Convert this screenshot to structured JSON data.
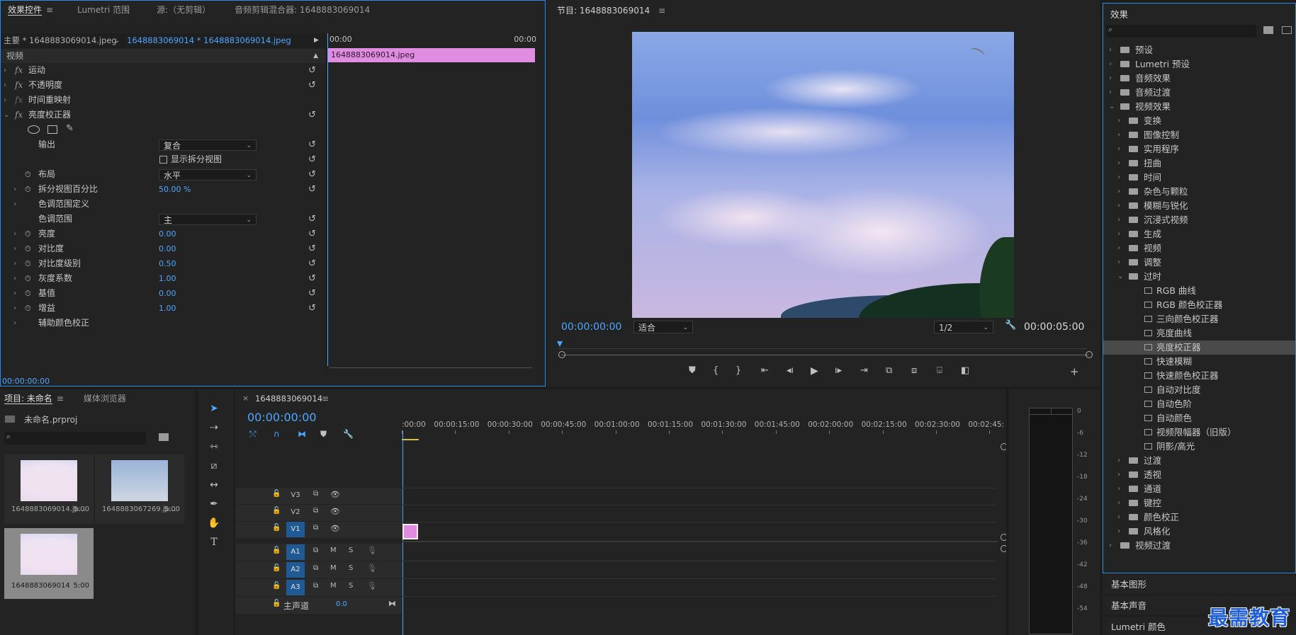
{
  "effect_controls": {
    "tabs": [
      "效果控件",
      "Lumetri 范围",
      "源:（无剪辑）",
      "音频剪辑混合器: 1648883069014"
    ],
    "master_clip": "主要 * 1648883069014.jpeg",
    "sequence_clip": "1648883069014 * 1648883069014.jpeg",
    "time_start": "00:00",
    "time_end": "00:00",
    "clip_bar_label": "1648883069014.jpeg",
    "section_video": "视频",
    "fx_rows": [
      {
        "label": "运动"
      },
      {
        "label": "不透明度"
      },
      {
        "label": "时间重映射"
      },
      {
        "label": "亮度校正器"
      }
    ],
    "output_label": "输出",
    "output_value": "复合",
    "split_view_label": "显示拆分视图",
    "layout_label": "布局",
    "layout_value": "水平",
    "split_pct_label": "拆分视图百分比",
    "split_pct_value": "50.00 %",
    "tonal_def_label": "色调范围定义",
    "tonal_range_label": "色调范围",
    "tonal_range_value": "主",
    "params": [
      {
        "label": "亮度",
        "value": "0.00"
      },
      {
        "label": "对比度",
        "value": "0.00"
      },
      {
        "label": "对比度级别",
        "value": "0.50"
      },
      {
        "label": "灰度系数",
        "value": "1.00"
      },
      {
        "label": "基值",
        "value": "0.00"
      },
      {
        "label": "增益",
        "value": "1.00"
      }
    ],
    "secondary_label": "辅助颜色校正",
    "footer_time": "00:00:00:00"
  },
  "program": {
    "title": "节目: 1648883069014",
    "current_time": "00:00:00:00",
    "fit": "适合",
    "resolution": "1/2",
    "duration": "00:00:05:00"
  },
  "effects": {
    "title": "效果",
    "items": [
      {
        "label": "预设",
        "level": 0,
        "kind": "folder",
        "open": false
      },
      {
        "label": "Lumetri 预设",
        "level": 0,
        "kind": "folder",
        "open": false
      },
      {
        "label": "音频效果",
        "level": 0,
        "kind": "folder",
        "open": false
      },
      {
        "label": "音频过渡",
        "level": 0,
        "kind": "folder",
        "open": false
      },
      {
        "label": "视频效果",
        "level": 0,
        "kind": "folder",
        "open": true
      },
      {
        "label": "变换",
        "level": 1,
        "kind": "folder",
        "open": false
      },
      {
        "label": "图像控制",
        "level": 1,
        "kind": "folder",
        "open": false
      },
      {
        "label": "实用程序",
        "level": 1,
        "kind": "folder",
        "open": false
      },
      {
        "label": "扭曲",
        "level": 1,
        "kind": "folder",
        "open": false
      },
      {
        "label": "时间",
        "level": 1,
        "kind": "folder",
        "open": false
      },
      {
        "label": "杂色与颗粒",
        "level": 1,
        "kind": "folder",
        "open": false
      },
      {
        "label": "模糊与锐化",
        "level": 1,
        "kind": "folder",
        "open": false
      },
      {
        "label": "沉浸式视频",
        "level": 1,
        "kind": "folder",
        "open": false
      },
      {
        "label": "生成",
        "level": 1,
        "kind": "folder",
        "open": false
      },
      {
        "label": "视频",
        "level": 1,
        "kind": "folder",
        "open": false
      },
      {
        "label": "调整",
        "level": 1,
        "kind": "folder",
        "open": false
      },
      {
        "label": "过时",
        "level": 1,
        "kind": "folder",
        "open": true
      },
      {
        "label": "RGB 曲线",
        "level": 2,
        "kind": "effect"
      },
      {
        "label": "RGB 颜色校正器",
        "level": 2,
        "kind": "effect"
      },
      {
        "label": "三向颜色校正器",
        "level": 2,
        "kind": "effect"
      },
      {
        "label": "亮度曲线",
        "level": 2,
        "kind": "effect"
      },
      {
        "label": "亮度校正器",
        "level": 2,
        "kind": "effect",
        "selected": true
      },
      {
        "label": "快速模糊",
        "level": 2,
        "kind": "effect"
      },
      {
        "label": "快速颜色校正器",
        "level": 2,
        "kind": "effect"
      },
      {
        "label": "自动对比度",
        "level": 2,
        "kind": "effect"
      },
      {
        "label": "自动色阶",
        "level": 2,
        "kind": "effect"
      },
      {
        "label": "自动颜色",
        "level": 2,
        "kind": "effect"
      },
      {
        "label": "视频限幅器（旧版）",
        "level": 2,
        "kind": "effect"
      },
      {
        "label": "阴影/高光",
        "level": 2,
        "kind": "effect"
      },
      {
        "label": "过渡",
        "level": 1,
        "kind": "folder",
        "open": false
      },
      {
        "label": "透视",
        "level": 1,
        "kind": "folder",
        "open": false
      },
      {
        "label": "通道",
        "level": 1,
        "kind": "folder",
        "open": false
      },
      {
        "label": "键控",
        "level": 1,
        "kind": "folder",
        "open": false
      },
      {
        "label": "颜色校正",
        "level": 1,
        "kind": "folder",
        "open": false
      },
      {
        "label": "风格化",
        "level": 1,
        "kind": "folder",
        "open": false
      },
      {
        "label": "视频过渡",
        "level": 0,
        "kind": "folder",
        "open": false
      }
    ],
    "bottom_panels": [
      "基本图形",
      "基本声音",
      "Lumetri 颜色"
    ]
  },
  "project": {
    "tabs": [
      "项目: 未命名",
      "媒体浏览器"
    ],
    "file": "未命名.prproj",
    "thumbs": [
      {
        "name": "1648883069014.jp...",
        "dur": "5:00"
      },
      {
        "name": "1648883067269.jp...",
        "dur": "5:00"
      },
      {
        "name": "1648883069014",
        "dur": "5:00"
      }
    ]
  },
  "timeline": {
    "tab": "1648883069014",
    "timecode": "00:00:00:00",
    "ruler": [
      ":00:00",
      "00:00:15:00",
      "00:00:30:00",
      "00:00:45:00",
      "00:01:00:00",
      "00:01:15:00",
      "00:01:30:00",
      "00:01:45:00",
      "00:02:00:00",
      "00:02:15:00",
      "00:02:30:00",
      "00:02:45:"
    ],
    "video_tracks": [
      "V3",
      "V2",
      "V1"
    ],
    "audio_tracks": [
      "A1",
      "A2",
      "A3"
    ],
    "master_label": "主声道",
    "master_value": "0.0",
    "mute": "M",
    "solo": "S"
  },
  "meter": {
    "scale": [
      "0",
      "-6",
      "-12",
      "-18",
      "-24",
      "-30",
      "-36",
      "-42",
      "-48",
      "-54"
    ]
  },
  "watermark": "最需教育"
}
